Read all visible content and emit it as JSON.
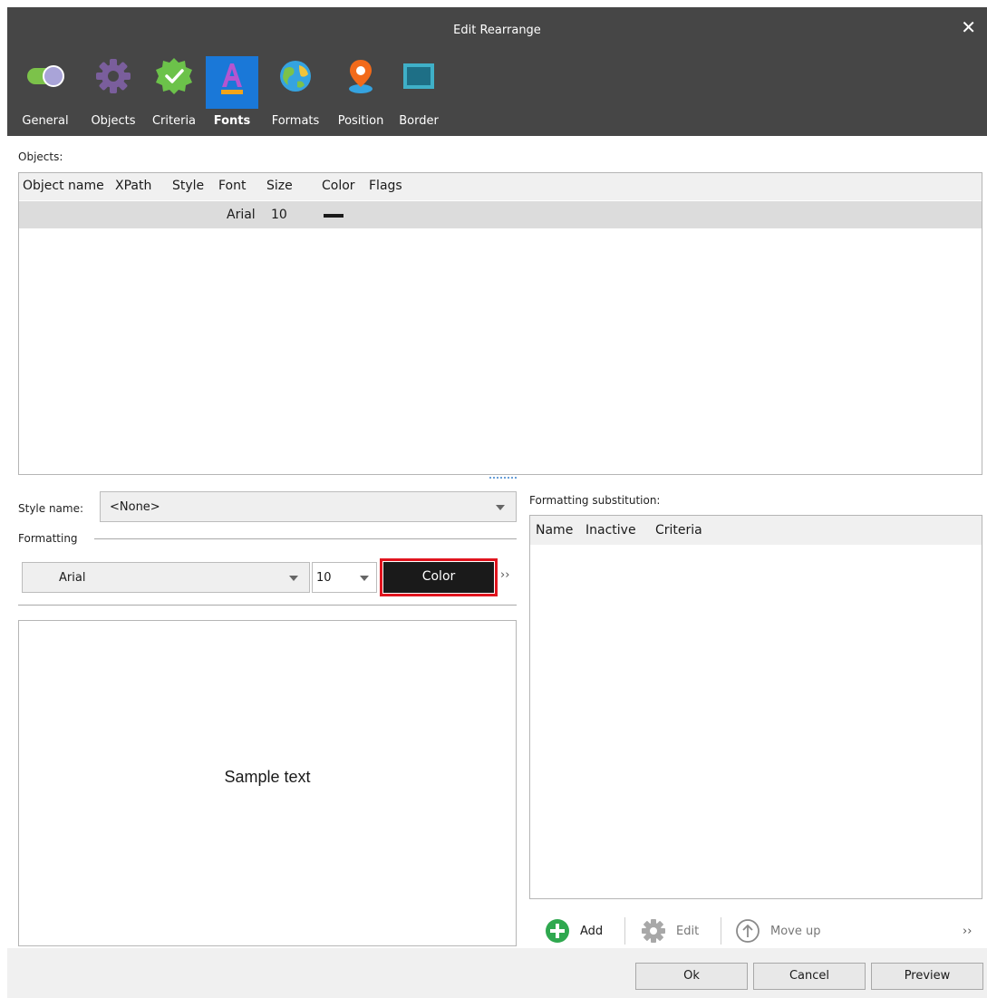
{
  "window": {
    "title": "Edit Rearrange",
    "close_glyph": "✕"
  },
  "toolbar": {
    "items": [
      {
        "label": "General",
        "icon": "toggle-icon"
      },
      {
        "label": "Objects",
        "icon": "gear-icon"
      },
      {
        "label": "Criteria",
        "icon": "checkmark-badge-icon"
      },
      {
        "label": "Fonts",
        "icon": "font-a-icon",
        "active": true
      },
      {
        "label": "Formats",
        "icon": "globe-icon"
      },
      {
        "label": "Position",
        "icon": "location-pin-icon"
      },
      {
        "label": "Border",
        "icon": "border-box-icon"
      }
    ]
  },
  "objects": {
    "label": "Objects:",
    "columns": [
      "Object name",
      "XPath",
      "Style",
      "Font",
      "Size",
      "Color",
      "Flags"
    ],
    "rows": [
      {
        "object_name": "",
        "xpath": "",
        "style": "",
        "font": "Arial",
        "size": "10",
        "color": "#1a1a1a",
        "flags": ""
      }
    ]
  },
  "style": {
    "label": "Style name:",
    "value": "<None>"
  },
  "formatting": {
    "label": "Formatting",
    "font_value": "Arial",
    "size_value": "10",
    "color_button": "Color",
    "more": "››",
    "sample_text": "Sample text"
  },
  "substitution": {
    "label": "Formatting substitution:",
    "columns": [
      "Name",
      "Inactive",
      "Criteria"
    ],
    "actions": {
      "add": "Add",
      "edit": "Edit",
      "move_up": "Move up",
      "more": "››"
    }
  },
  "footer": {
    "ok": "Ok",
    "cancel": "Cancel",
    "preview": "Preview"
  },
  "colors": {
    "accent": "#1a78d8",
    "highlight": "#e0141e",
    "titlebar": "#464646"
  }
}
